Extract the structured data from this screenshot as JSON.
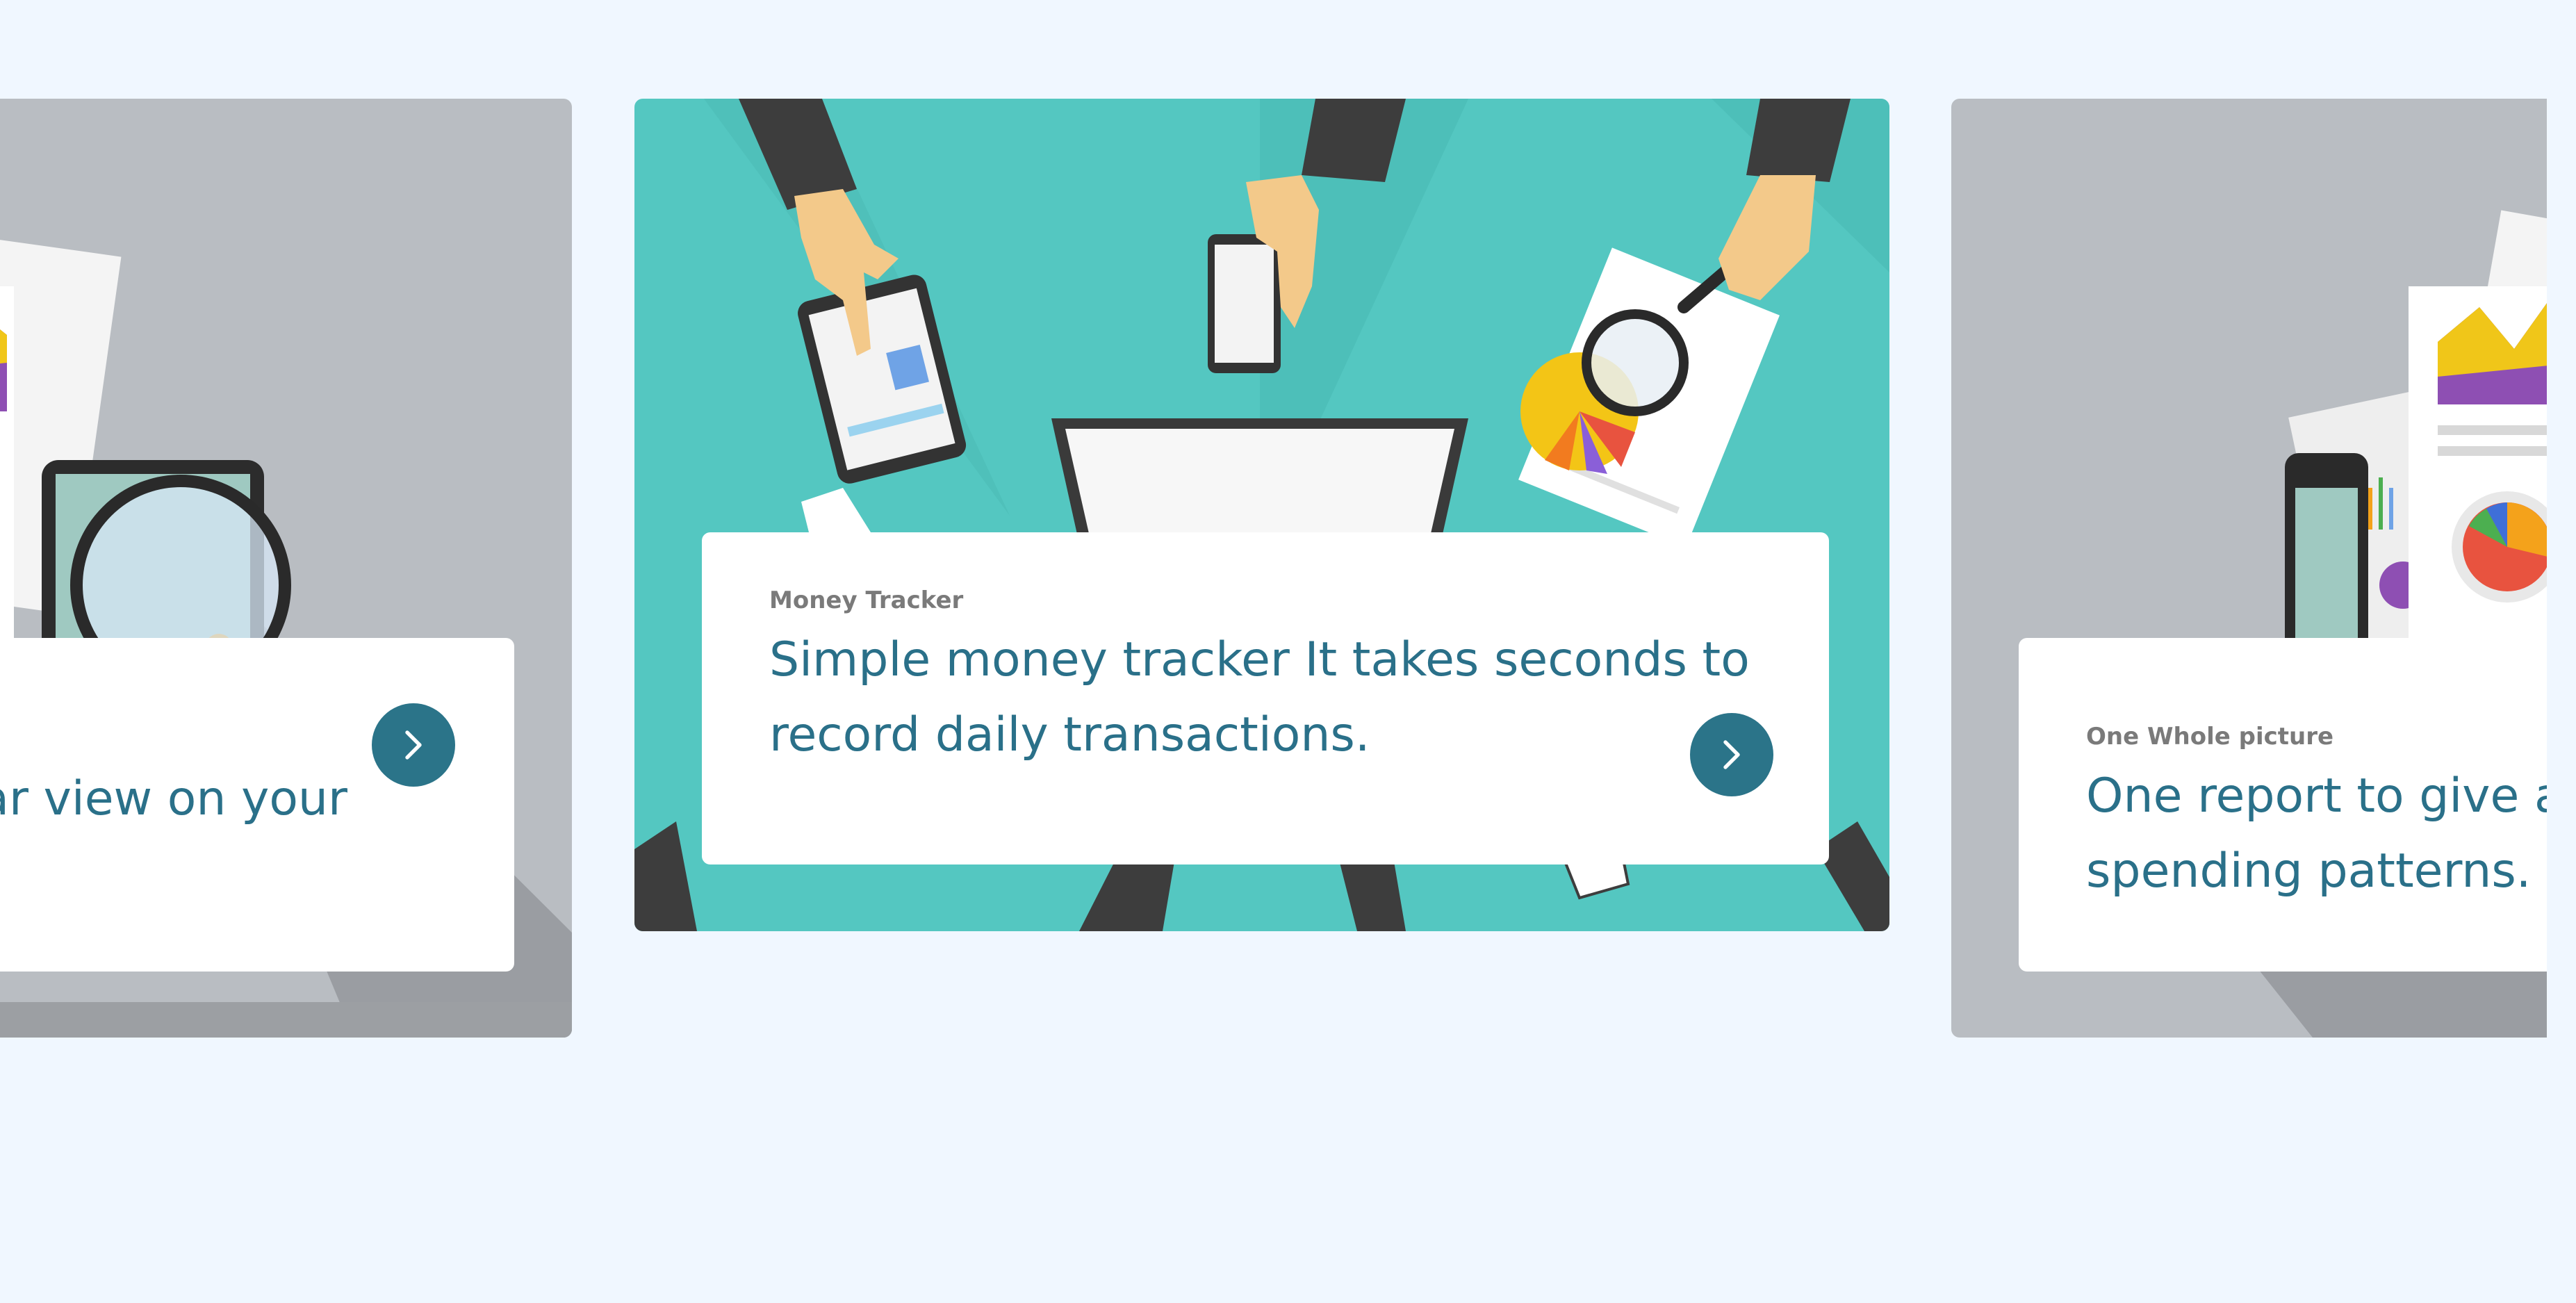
{
  "carousel": {
    "cards": [
      {
        "eyebrow": "",
        "headline_line1": "ar view on your",
        "headline_line2": ""
      },
      {
        "eyebrow": "Money Tracker",
        "headline_line1": "Simple money tracker It takes seconds to",
        "headline_line2": "record daily transactions."
      },
      {
        "eyebrow": "One Whole picture",
        "headline_line1": "One report to give a",
        "headline_line2": "spending patterns."
      }
    ],
    "next_icon": "chevron-right-icon"
  },
  "colors": {
    "page_bg": "#f0f7ff",
    "accent": "#2b7489",
    "headline": "#2a7089",
    "teal_card": "#54c7c1",
    "gray_card": "#b9bdc2"
  }
}
